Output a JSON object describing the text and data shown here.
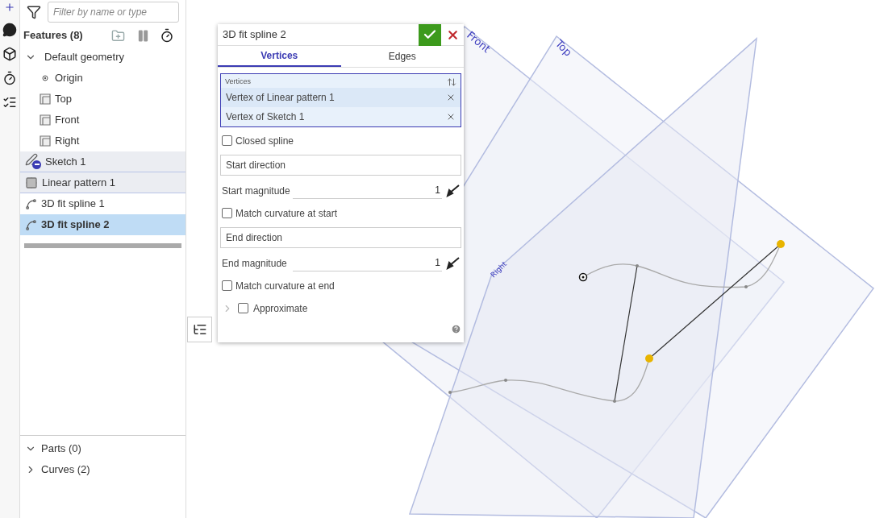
{
  "filter": {
    "placeholder": "Filter by name or type"
  },
  "features": {
    "title": "Features (8)",
    "items": [
      {
        "label": "Default geometry",
        "kind": "group",
        "expanded": true,
        "selected": false,
        "highlighted": false,
        "children": [
          {
            "label": "Origin",
            "kind": "origin",
            "selected": false,
            "highlighted": false
          },
          {
            "label": "Top",
            "kind": "plane",
            "selected": false,
            "highlighted": false
          },
          {
            "label": "Front",
            "kind": "plane",
            "selected": false,
            "highlighted": false
          },
          {
            "label": "Right",
            "kind": "plane",
            "selected": false,
            "highlighted": false
          }
        ]
      },
      {
        "label": "Sketch 1",
        "kind": "sketch",
        "selected": false,
        "highlighted": true
      },
      {
        "label": "Linear pattern 1",
        "kind": "pattern",
        "selected": false,
        "highlighted": true
      },
      {
        "label": "3D fit spline 1",
        "kind": "spline",
        "selected": false,
        "highlighted": false
      },
      {
        "label": "3D fit spline 2",
        "kind": "spline",
        "selected": true,
        "highlighted": false
      }
    ]
  },
  "bottom_sections": [
    {
      "label": "Parts (0)",
      "expanded": true
    },
    {
      "label": "Curves (2)",
      "expanded": false
    }
  ],
  "dialog": {
    "title": "3D fit spline 2",
    "tabs": [
      {
        "label": "Vertices",
        "selected": true
      },
      {
        "label": "Edges",
        "selected": false
      }
    ],
    "selection": {
      "label": "Vertices",
      "items": [
        {
          "label": "Vertex of Linear pattern 1",
          "highlighted": true
        },
        {
          "label": "Vertex of Sketch 1",
          "highlighted": false
        }
      ]
    },
    "fields": [
      {
        "kind": "checkbox",
        "label": "Closed spline",
        "checked": false
      },
      {
        "kind": "direction",
        "placeholder": "Start direction"
      },
      {
        "kind": "magnitude",
        "label": "Start magnitude",
        "value": "1"
      },
      {
        "kind": "checkbox",
        "label": "Match curvature at start",
        "checked": false
      },
      {
        "kind": "direction",
        "placeholder": "End direction"
      },
      {
        "kind": "magnitude",
        "label": "End magnitude",
        "value": "1"
      },
      {
        "kind": "checkbox",
        "label": "Match curvature at end",
        "checked": false
      }
    ],
    "approximate": {
      "label": "Approximate",
      "checked": false,
      "expanded": false
    }
  },
  "viewport": {
    "planes": [
      {
        "label": "Front"
      },
      {
        "label": "Top"
      },
      {
        "label": "Right"
      }
    ]
  }
}
